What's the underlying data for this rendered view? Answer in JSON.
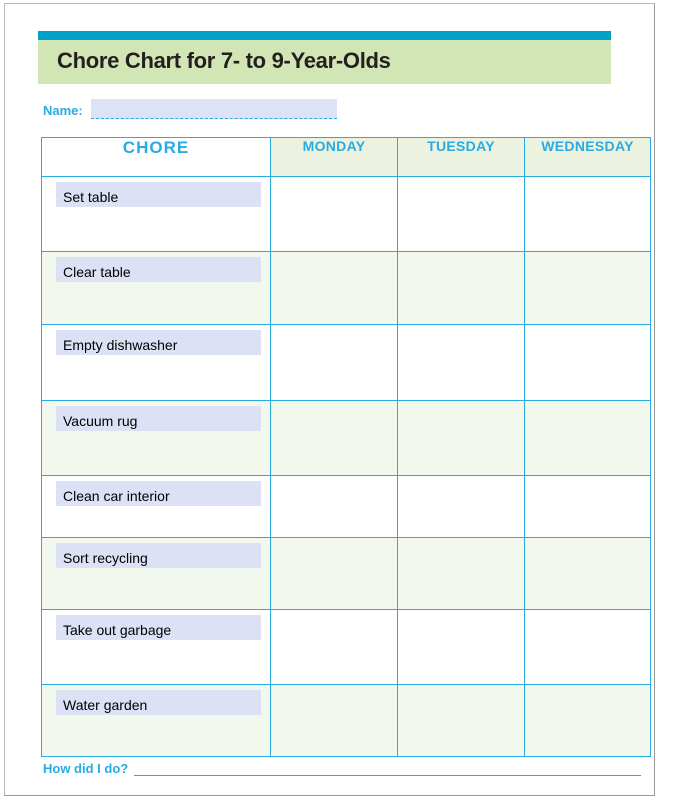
{
  "document": {
    "title": "Chore Chart for 7- to 9-Year-Olds"
  },
  "name_field": {
    "label": "Name:",
    "value": "",
    "placeholder": ""
  },
  "table": {
    "headers": [
      "CHORE",
      "MONDAY",
      "TUESDAY",
      "WEDNESDAY"
    ],
    "chore_header": "CHORE",
    "day_headers": [
      "MONDAY",
      "TUESDAY",
      "WEDNESDAY"
    ],
    "rows": [
      {
        "chore": "Set table",
        "monday": "",
        "tuesday": "",
        "wednesday": ""
      },
      {
        "chore": "Clear table",
        "monday": "",
        "tuesday": "",
        "wednesday": ""
      },
      {
        "chore": "Empty dishwasher",
        "monday": "",
        "tuesday": "",
        "wednesday": ""
      },
      {
        "chore": "Vacuum rug",
        "monday": "",
        "tuesday": "",
        "wednesday": ""
      },
      {
        "chore": "Clean car interior",
        "monday": "",
        "tuesday": "",
        "wednesday": ""
      },
      {
        "chore": "Sort recycling",
        "monday": "",
        "tuesday": "",
        "wednesday": ""
      },
      {
        "chore": "Take out garbage",
        "monday": "",
        "tuesday": "",
        "wednesday": ""
      },
      {
        "chore": "Water garden",
        "monday": "",
        "tuesday": "",
        "wednesday": ""
      }
    ]
  },
  "footer": {
    "label": "How did I do?",
    "response": ""
  },
  "colors": {
    "accent_bar": "#00a0c8",
    "title_band": "#d2e5b4",
    "teal_text": "#29abe2",
    "day_header_bg": "#ebf3e0",
    "row_tint": "#f3f8ee",
    "chore_box": "#dce1f5",
    "title_text": "#231f20",
    "page_border": "#b9b9b9"
  }
}
